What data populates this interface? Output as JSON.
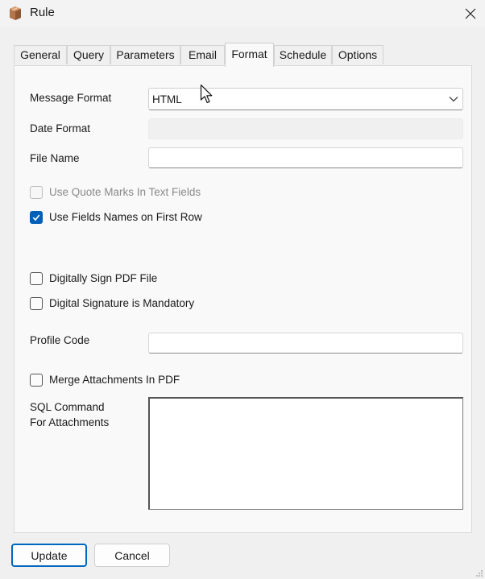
{
  "window": {
    "title": "Rule",
    "icon": "box-icon"
  },
  "tabs": [
    {
      "label": "General",
      "active": false
    },
    {
      "label": "Query",
      "active": false
    },
    {
      "label": "Parameters",
      "active": false
    },
    {
      "label": "Email",
      "active": false
    },
    {
      "label": "Format",
      "active": true
    },
    {
      "label": "Schedule",
      "active": false
    },
    {
      "label": "Options",
      "active": false
    }
  ],
  "form": {
    "message_format": {
      "label": "Message Format",
      "value": "HTML"
    },
    "date_format": {
      "label": "Date Format",
      "value": ""
    },
    "file_name": {
      "label": "File Name",
      "value": ""
    },
    "use_quote_marks": {
      "label": "Use Quote Marks In Text Fields",
      "checked": false,
      "enabled": false
    },
    "use_field_names": {
      "label": "Use Fields Names on First Row",
      "checked": true,
      "enabled": true
    },
    "digitally_sign": {
      "label": "Digitally Sign PDF File",
      "checked": false
    },
    "signature_mandatory": {
      "label": "Digital Signature is Mandatory",
      "checked": false
    },
    "profile_code": {
      "label": "Profile Code",
      "value": ""
    },
    "merge_attachments": {
      "label": "Merge Attachments In PDF",
      "checked": false
    },
    "sql_command": {
      "label_line1": "SQL Command",
      "label_line2": "For Attachments",
      "value": ""
    }
  },
  "buttons": {
    "update": "Update",
    "cancel": "Cancel"
  },
  "colors": {
    "accent": "#005fb8",
    "default_button_border": "#0067c0"
  }
}
